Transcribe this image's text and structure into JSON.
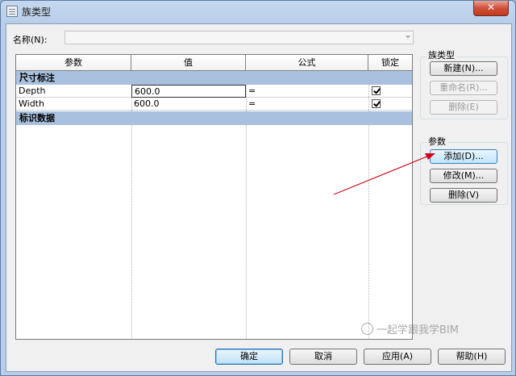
{
  "window": {
    "title": "族类型",
    "close_glyph": "✕"
  },
  "name_field": {
    "label": "名称(N):",
    "value": ""
  },
  "table": {
    "headers": [
      "参数",
      "值",
      "公式",
      "锁定"
    ],
    "groups": [
      {
        "title": "尺寸标注",
        "chevron": "˄˄"
      },
      {
        "title": "标识数据",
        "chevron": "˅˅"
      }
    ],
    "rows": [
      {
        "param": "Depth",
        "value": "600.0",
        "formula": "=",
        "locked": true
      },
      {
        "param": "Width",
        "value": "600.0",
        "formula": "=",
        "locked": true
      }
    ]
  },
  "family_types": {
    "label": "族类型",
    "buttons": [
      {
        "label": "新建(N)...",
        "enabled": true
      },
      {
        "label": "重命名(R)...",
        "enabled": false
      },
      {
        "label": "删除(E)",
        "enabled": false
      }
    ]
  },
  "parameters": {
    "label": "参数",
    "buttons": [
      {
        "label": "添加(D)...",
        "enabled": true
      },
      {
        "label": "修改(M)...",
        "enabled": true
      },
      {
        "label": "删除(V)",
        "enabled": true
      }
    ]
  },
  "footer": {
    "ok": "确定",
    "cancel": "取消",
    "apply": "应用(A)",
    "help": "帮助(H)"
  },
  "watermark": "一起学跟我学BIM",
  "colors": {
    "annotation_arrow": "#d0021b",
    "group_header": "#a9c1de"
  }
}
